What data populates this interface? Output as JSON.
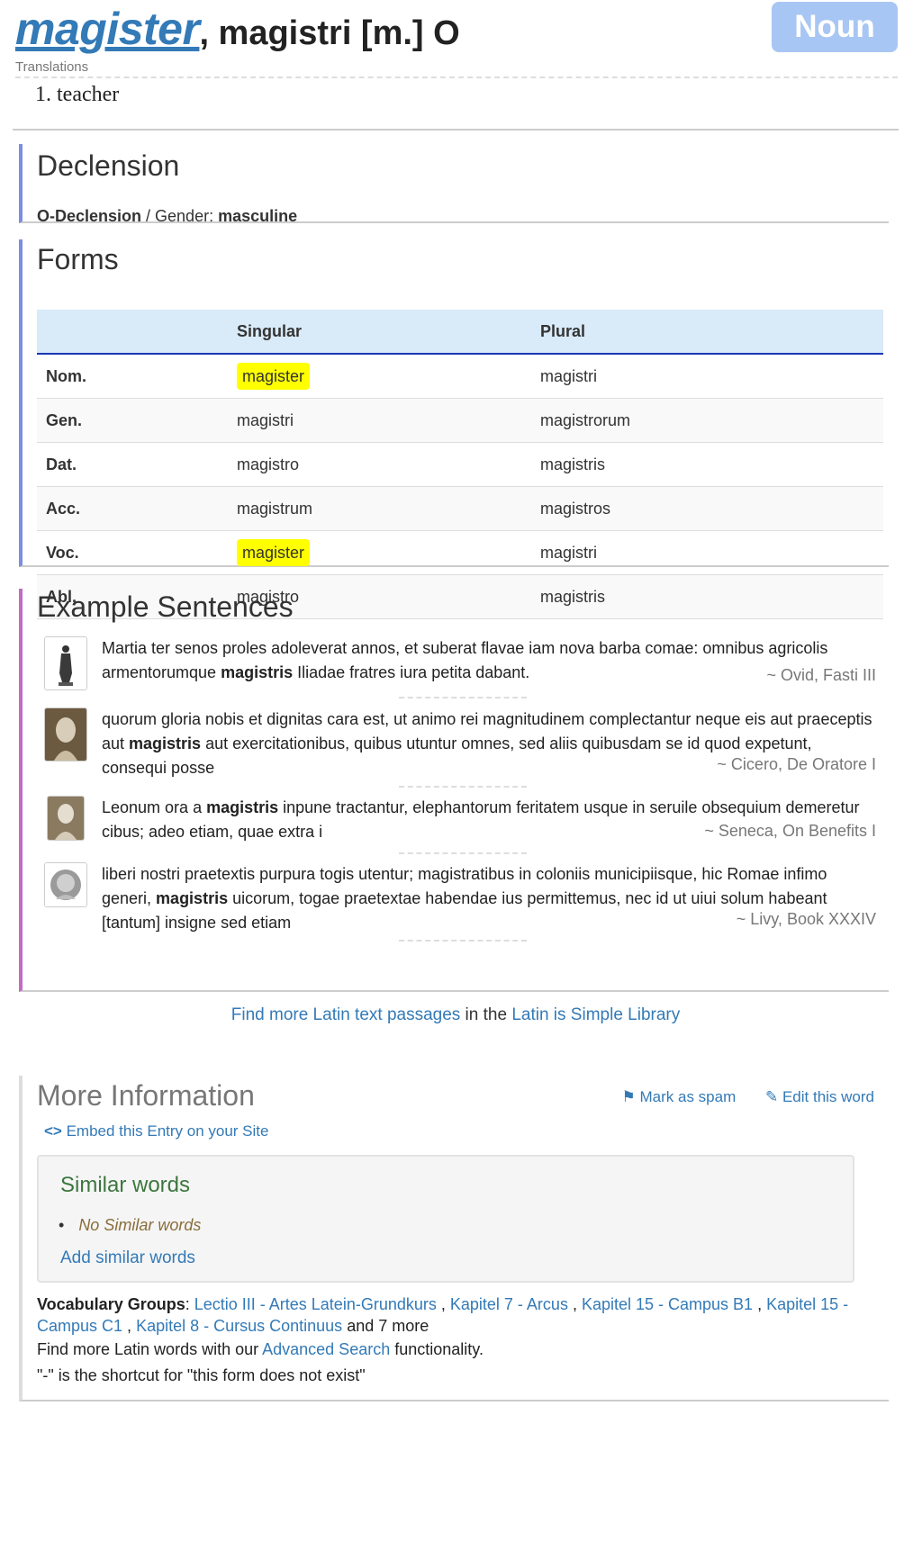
{
  "entry": {
    "headword": "magister",
    "header_rest": ", magistri  [m.] O",
    "pos_badge": "Noun",
    "translations_label": "Translations",
    "translations": [
      "1. teacher"
    ]
  },
  "declension": {
    "title": "Declension",
    "declension_type": "O-Declension",
    "separator": " / Gender: ",
    "gender": "masculine"
  },
  "forms": {
    "title": "Forms",
    "headers": [
      "",
      "Singular",
      "Plural"
    ],
    "rows": [
      {
        "case": "Nom.",
        "singular": "magister",
        "plural": "magistri",
        "highlight": true
      },
      {
        "case": "Gen.",
        "singular": "magistri",
        "plural": "magistrorum",
        "highlight": false
      },
      {
        "case": "Dat.",
        "singular": "magistro",
        "plural": "magistris",
        "highlight": false
      },
      {
        "case": "Acc.",
        "singular": "magistrum",
        "plural": "magistros",
        "highlight": false
      },
      {
        "case": "Voc.",
        "singular": "magister",
        "plural": "magistri",
        "highlight": true
      },
      {
        "case": "Abl.",
        "singular": "magistro",
        "plural": "magistris",
        "highlight": false
      }
    ]
  },
  "examples": {
    "title": "Example Sentences",
    "items": [
      {
        "before": "Martia ter senos proles adoleverat annos, et suberat flavae iam nova barba comae: omnibus agricolis armentorumque ",
        "bold": "magistris",
        "after": " Iliadae fratres iura petita dabant.",
        "source": "~ Ovid, Fasti III",
        "icon": "statue-icon"
      },
      {
        "before": "quorum gloria nobis et dignitas cara est, ut animo rei magnitudinem complectantur neque eis aut praeceptis aut ",
        "bold": "magistris",
        "after": " aut exercitationibus, quibus utuntur omnes, sed aliis quibusdam se id quod expetunt, consequi posse",
        "source": "~ Cicero, De Oratore I",
        "icon": "bust-portrait-icon"
      },
      {
        "before": "Leonum ora a ",
        "bold": "magistris",
        "after": " inpune tractantur, elephantorum feritatem usque in seruile obsequium demeretur cibus; adeo etiam, quae extra i",
        "source": "~ Seneca, On Benefits I",
        "icon": "bust-portrait-icon"
      },
      {
        "before": "liberi nostri praetextis purpura togis utentur; magistratibus in coloniis municipiisque, hic Romae infimo generi, ",
        "bold": "magistris",
        "after": " uicorum, togae praetextae habendae ius permittemus, nec id ut uiui solum habeant [tantum] insigne sed etiam",
        "source": "~ Livy, Book XXXIV",
        "icon": "bust-portrait-icon"
      }
    ],
    "find_more_link": "Find more Latin text passages",
    "find_more_mid": " in the ",
    "library_link": "Latin is Simple Library"
  },
  "more_info": {
    "title": "More Information",
    "mark_spam": "Mark as spam",
    "edit_word": "Edit this word",
    "embed": "Embed this Entry on your Site",
    "similar_title": "Similar words",
    "no_similar": "No Similar words",
    "add_similar": "Add similar words",
    "vocab_label": "Vocabulary Groups",
    "vocab_groups": [
      "Lectio III - Artes Latein-Grundkurs",
      "Kapitel 7 - Arcus",
      "Kapitel 15 - Campus B1",
      "Kapitel 15 - Campus C1",
      "Kapitel 8 - Cursus Continuus"
    ],
    "vocab_more": " and 7 more",
    "adv_before": "Find more Latin words with our ",
    "adv_link": "Advanced Search",
    "adv_after": " functionality.",
    "shortcut": "\"-\" is the shortcut for \"this form does not exist\""
  },
  "colors": {
    "link": "#337ab7",
    "badge": "#a8c6f3",
    "highlight": "#ffff00",
    "declension_bar": "#7b8fe0",
    "examples_bar": "#c26bc7",
    "similar_title": "#3c763d"
  }
}
